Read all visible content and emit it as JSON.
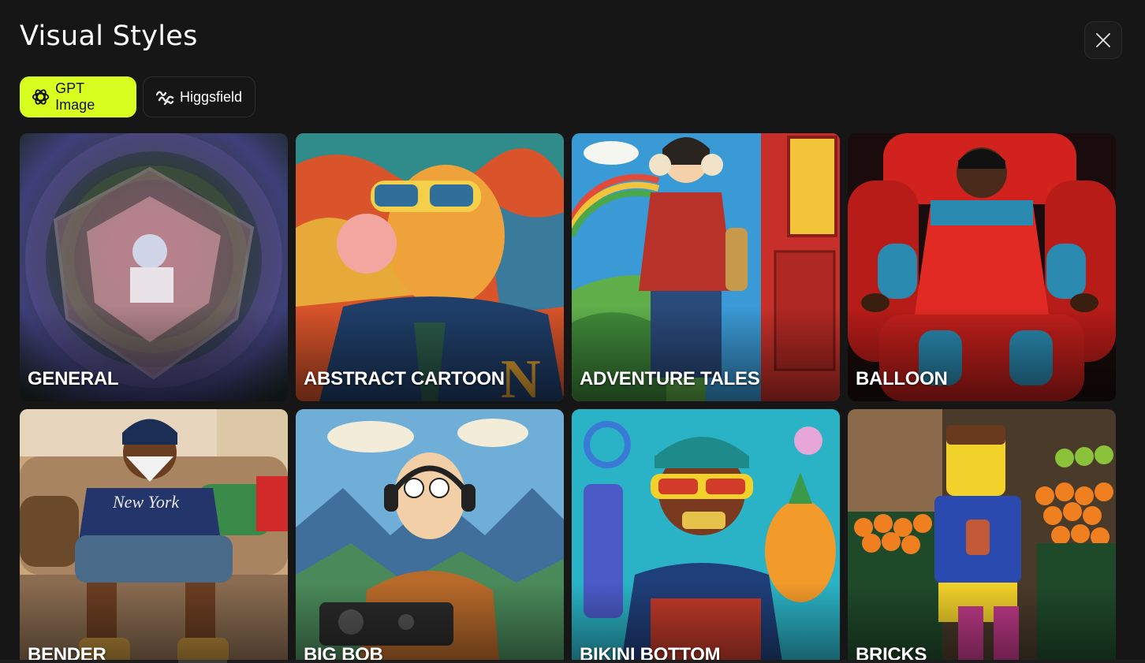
{
  "modal": {
    "title": "Visual Styles",
    "close_icon": "close-icon"
  },
  "tabs": [
    {
      "label": "GPT Image",
      "icon": "openai-icon",
      "active": true
    },
    {
      "label": "Higgsfield",
      "icon": "higgsfield-icon",
      "active": false
    }
  ],
  "styles": [
    {
      "label": "GENERAL"
    },
    {
      "label": "ABSTRACT CARTOON"
    },
    {
      "label": "ADVENTURE TALES"
    },
    {
      "label": "BALLOON"
    },
    {
      "label": "BENDER"
    },
    {
      "label": "BIG BOB"
    },
    {
      "label": "BIKINI BOTTOM"
    },
    {
      "label": "BRICKS"
    }
  ],
  "colors": {
    "background": "#161616",
    "accent": "#d8ff1f"
  }
}
